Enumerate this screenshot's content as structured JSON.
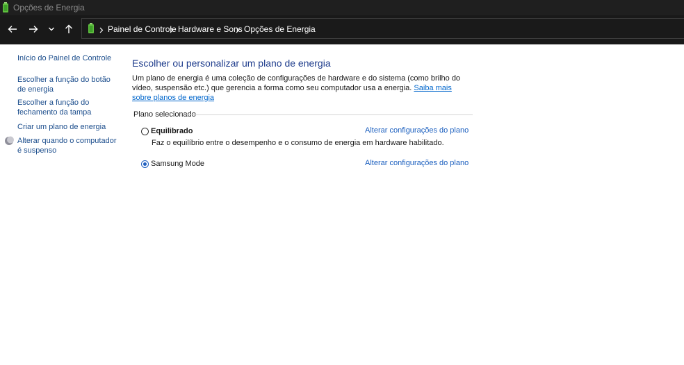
{
  "window": {
    "title": "Opções de Energia",
    "icon": "battery-icon"
  },
  "nav": {
    "back_icon": "arrow-left-icon",
    "forward_icon": "arrow-right-icon",
    "recent_icon": "chevron-down-icon",
    "up_icon": "arrow-up-icon"
  },
  "address": {
    "icon": "battery-icon",
    "separator_icon": "chevron-right-icon",
    "breadcrumbs": [
      "Painel de Controle",
      "Hardware e Sons",
      "Opções de Energia"
    ]
  },
  "sidebar": {
    "items": [
      {
        "label": "Início do Painel de Controle"
      },
      {
        "label": "Escolher a função do botão de energia"
      },
      {
        "label": "Escolher a função do fechamento da tampa"
      },
      {
        "label": "Criar um plano de energia"
      },
      {
        "label": "Alterar quando o computador é suspenso",
        "icon": "moon-icon"
      }
    ]
  },
  "main": {
    "heading": "Escolher ou personalizar um plano de energia",
    "description": "Um plano de energia é uma coleção de configurações de hardware e do sistema (como brilho do vídeo, suspensão etc.) que gerencia a forma como seu computador usa a energia.",
    "learn_more": "Saiba mais sobre planos de energia",
    "section_label": "Plano selecionado",
    "plans": [
      {
        "name": "Equilibrado",
        "selected": false,
        "description": "Faz o equilíbrio entre o desempenho e o consumo de energia em hardware habilitado.",
        "link": "Alterar configurações do plano"
      },
      {
        "name": "Samsung Mode",
        "selected": true,
        "link": "Alterar configurações do plano"
      }
    ]
  },
  "colors": {
    "titlebar_bg": "#1f1f1f",
    "navbar_bg": "#191919",
    "link": "#1b4d8c",
    "heading": "#1e3c8c",
    "battery_green": "#5fbf3f"
  }
}
